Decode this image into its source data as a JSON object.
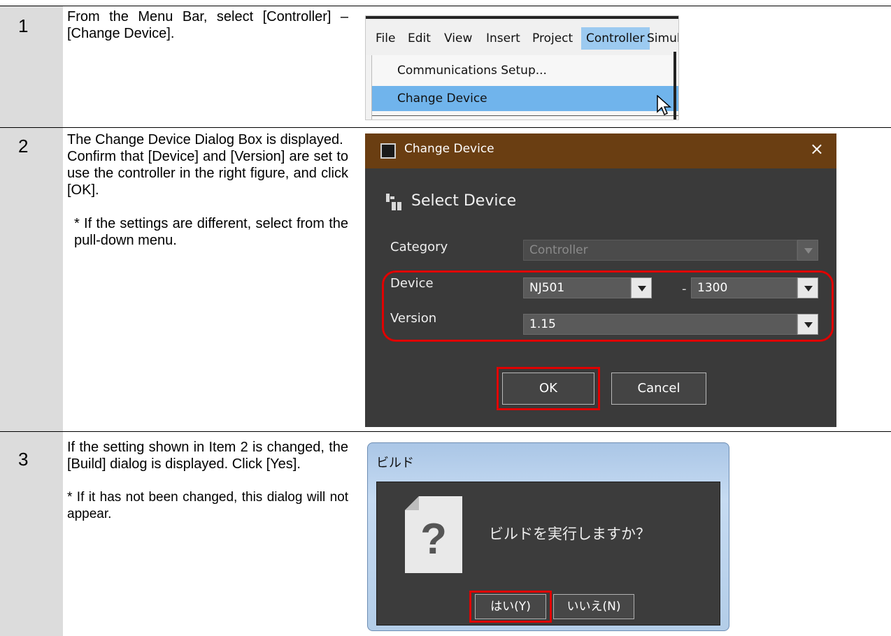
{
  "steps": [
    {
      "number": "1",
      "text": "From the Menu Bar, select [Controller] – [Change Device]."
    },
    {
      "number": "2",
      "text_a": "The Change Device Dialog Box is displayed.",
      "text_b": "Confirm that [Device] and [Version] are set to use the controller in the right figure, and click [OK].",
      "note": "* If the settings are different, select from the pull-down menu."
    },
    {
      "number": "3",
      "text": "If the setting shown in Item 2 is changed, the [Build] dialog is displayed. Click [Yes].",
      "note": "* If it has not been changed, this dialog will not appear."
    }
  ],
  "menu": {
    "items": [
      "File",
      "Edit",
      "View",
      "Insert",
      "Project",
      "Controller",
      "Simula"
    ],
    "active": "Controller",
    "dropdown": [
      "Communications Setup...",
      "Change Device"
    ],
    "selected": "Change Device"
  },
  "change_device_dialog": {
    "title": "Change Device",
    "close": "×",
    "heading": "Select Device",
    "category_label": "Category",
    "category_value": "Controller",
    "device_label": "Device",
    "device_value": "NJ501",
    "device_dash": "-",
    "device_model": "1300",
    "version_label": "Version",
    "version_value": "1.15",
    "ok": "OK",
    "cancel": "Cancel",
    "highlight_color": "#e00000",
    "titlebar_color": "#6a3e12"
  },
  "build_dialog": {
    "title": "ビルド",
    "icon": "question-icon",
    "message": "ビルドを実行しますか？",
    "yes": "はい(Y)",
    "no": "いいえ(N)"
  }
}
